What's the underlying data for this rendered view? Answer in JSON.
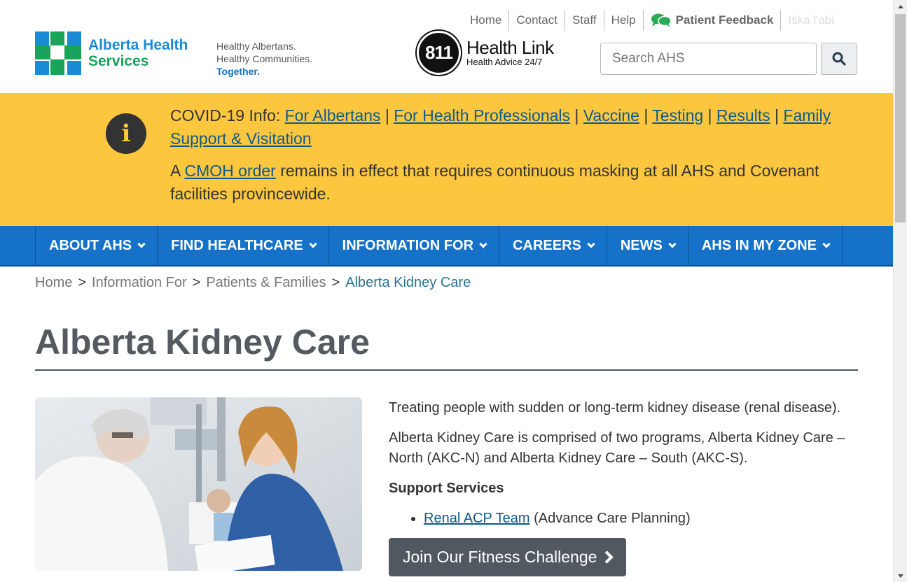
{
  "header": {
    "logo": {
      "line1": "Alberta Health",
      "line2": "Services"
    },
    "tagline": {
      "line1": "Healthy Albertans.",
      "line2": "Healthy Communities.",
      "line3": "Together."
    },
    "healthlink": {
      "number": "811",
      "title": "Health Link",
      "subtitle": "Health Advice 24/7"
    },
    "utility_links": [
      "Home",
      "Contact",
      "Staff",
      "Help"
    ],
    "patient_feedback": "Patient Feedback",
    "language_link": "Iska l'abi",
    "search": {
      "placeholder": "Search AHS"
    }
  },
  "covid_banner": {
    "label": "COVID-19 Info:",
    "links": [
      "For Albertans",
      "For Health Professionals",
      "Vaccine",
      "Testing",
      "Results",
      "Family Support & Visitation"
    ],
    "separator": "|",
    "notice_prefix": "A",
    "notice_link": "CMOH order",
    "notice_suffix": "remains in effect that requires continuous masking at all AHS and Covenant facilities provincewide."
  },
  "nav": {
    "items": [
      "ABOUT AHS",
      "FIND HEALTHCARE",
      "INFORMATION FOR",
      "CAREERS",
      "NEWS",
      "AHS IN MY ZONE"
    ]
  },
  "breadcrumb": {
    "items": [
      "Home",
      "Information For",
      "Patients & Families"
    ],
    "separator": ">",
    "current": "Alberta Kidney Care"
  },
  "page": {
    "title": "Alberta Kidney Care",
    "intro": "Treating people with sudden or long-term kidney disease (renal disease).",
    "description": "Alberta Kidney Care is comprised of two programs, Alberta Kidney Care – North (AKC-N) and Alberta Kidney Care – South (AKC-S).",
    "support_heading": "Support Services",
    "support_link": "Renal ACP Team",
    "support_link_note": "(Advance Care Planning)",
    "cta": "Join Our Fitness Challenge"
  },
  "colors": {
    "brand_blue": "#1a8bd5",
    "brand_green": "#1aa35b",
    "nav_blue": "#1572c8",
    "banner_yellow": "#fcc73f",
    "link": "#0e5a8a"
  }
}
